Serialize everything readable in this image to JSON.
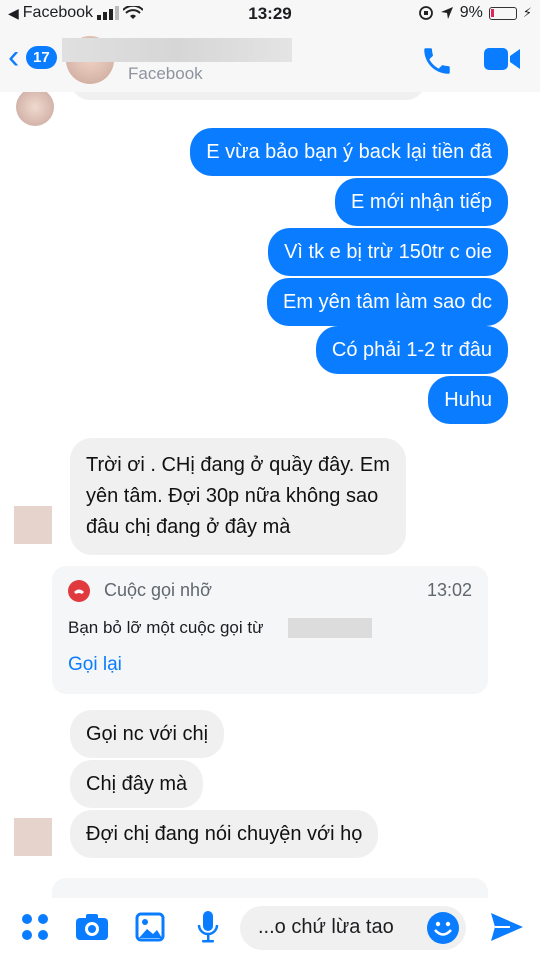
{
  "status_bar": {
    "carrier": "Facebook",
    "time": "13:29",
    "battery": "9%"
  },
  "header": {
    "back_count": "17",
    "subtitle": "Facebook"
  },
  "messages": {
    "out": [
      "E vừa bảo bạn ý back lại tiền đã",
      "E mới nhận tiếp",
      "Vì tk e bị trừ 150tr c oie",
      "Em yên tâm làm sao dc",
      "Có phải 1-2 tr đâu",
      "Huhu"
    ],
    "in_block_1": [
      "Trời ơi . CHị đang ở quầy đây. Em",
      "yên tâm. Đợi 30p nữa không sao",
      "đâu chị đang ở đây mà"
    ],
    "in_block_2": [
      "Gọi nc với chị",
      "Chị đây mà",
      "Đợi chị đang nói chuyện với họ"
    ]
  },
  "missed_call": {
    "title": "Cuộc gọi nhỡ",
    "time": "13:02",
    "body": "Bạn bỏ lỡ một cuộc gọi từ",
    "action": "Gọi lại"
  },
  "composer": {
    "text": "...o chứ lừa tao"
  },
  "colors": {
    "accent": "#0a7cff",
    "incoming_bubble": "#f1f0f0",
    "missed": "#e0393e"
  },
  "icons": [
    "signal-icon",
    "wifi-icon",
    "lock-rotation-icon",
    "location-icon",
    "battery-icon",
    "back-chevron-icon",
    "phone-icon",
    "video-icon",
    "more-icon",
    "camera-icon",
    "image-icon",
    "microphone-icon",
    "emoji-icon",
    "send-icon"
  ]
}
